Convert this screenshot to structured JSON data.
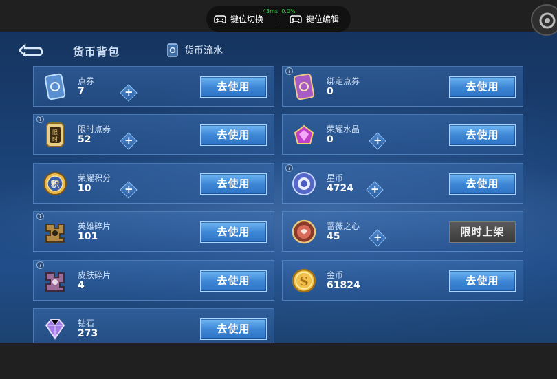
{
  "header": {
    "title": "货币背包",
    "flow_label": "货币流水"
  },
  "overlay": {
    "left_label": "键位切换",
    "right_label": "键位编辑",
    "stats_ms": "43ms",
    "stats_pct": "0.0%"
  },
  "use_label": "去使用",
  "currencies": [
    {
      "name": "点券",
      "amount": "7",
      "plus": true,
      "help": false,
      "action": "去使用",
      "icon": "coupon-icon"
    },
    {
      "name": "绑定点券",
      "amount": "0",
      "plus": false,
      "help": true,
      "action": "去使用",
      "icon": "bound-coupon-icon"
    },
    {
      "name": "限时点券",
      "amount": "52",
      "plus": true,
      "help": true,
      "action": "去使用",
      "icon": "limited-coupon-icon"
    },
    {
      "name": "荣耀水晶",
      "amount": "0",
      "plus": true,
      "help": false,
      "action": "去使用",
      "icon": "glory-crystal-icon"
    },
    {
      "name": "荣耀积分",
      "amount": "10",
      "plus": true,
      "help": false,
      "action": "去使用",
      "icon": "glory-points-icon"
    },
    {
      "name": "星币",
      "amount": "4724",
      "plus": true,
      "help": true,
      "action": "去使用",
      "icon": "star-coin-icon"
    },
    {
      "name": "英雄碎片",
      "amount": "101",
      "plus": false,
      "help": true,
      "action": "去使用",
      "icon": "hero-shard-icon"
    },
    {
      "name": "蔷薇之心",
      "amount": "45",
      "plus": true,
      "help": false,
      "action": "限时上架",
      "icon": "rose-heart-icon"
    },
    {
      "name": "皮肤碎片",
      "amount": "4",
      "plus": false,
      "help": true,
      "action": "去使用",
      "icon": "skin-shard-icon"
    },
    {
      "name": "金币",
      "amount": "61824",
      "plus": false,
      "help": false,
      "action": "去使用",
      "icon": "gold-coin-icon"
    },
    {
      "name": "钻石",
      "amount": "273",
      "plus": false,
      "help": false,
      "action": "去使用",
      "icon": "diamond-icon"
    }
  ]
}
